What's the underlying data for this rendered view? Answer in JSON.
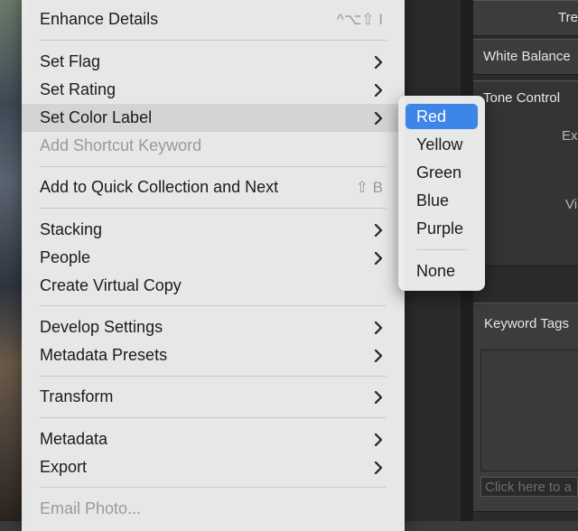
{
  "menu": {
    "items": [
      {
        "label": "Enhance Details",
        "shortcut": "^⌥⇧ I",
        "submenu": false,
        "disabled": false
      },
      {
        "label": "Set Flag",
        "submenu": true,
        "disabled": false
      },
      {
        "label": "Set Rating",
        "submenu": true,
        "disabled": false
      },
      {
        "label": "Set Color Label",
        "submenu": true,
        "disabled": false,
        "highlighted": true
      },
      {
        "label": "Add Shortcut Keyword",
        "submenu": false,
        "disabled": true
      },
      {
        "label": "Add to Quick Collection and Next",
        "shortcut": "⇧ B",
        "submenu": false,
        "disabled": false
      },
      {
        "label": "Stacking",
        "submenu": true,
        "disabled": false
      },
      {
        "label": "People",
        "submenu": true,
        "disabled": false
      },
      {
        "label": "Create Virtual Copy",
        "submenu": false,
        "disabled": false
      },
      {
        "label": "Develop Settings",
        "submenu": true,
        "disabled": false
      },
      {
        "label": "Metadata Presets",
        "submenu": true,
        "disabled": false
      },
      {
        "label": "Transform",
        "submenu": true,
        "disabled": false
      },
      {
        "label": "Metadata",
        "submenu": true,
        "disabled": false
      },
      {
        "label": "Export",
        "submenu": true,
        "disabled": false
      },
      {
        "label": "Email Photo...",
        "submenu": false,
        "disabled": true
      }
    ]
  },
  "color_label_submenu": {
    "items": [
      "Red",
      "Yellow",
      "Green",
      "Blue",
      "Purple",
      "None"
    ],
    "selected": "Red",
    "selected_color": "#3d85e6"
  },
  "right_panel": {
    "treatment_partial": "Tre",
    "white_balance": "White Balance",
    "tone_control": "Tone Control",
    "exposure_partial": "Ex",
    "vibrance_partial": "Vi",
    "keyword_tags": "Keyword Tags",
    "keyword_placeholder": "Click here to a"
  }
}
